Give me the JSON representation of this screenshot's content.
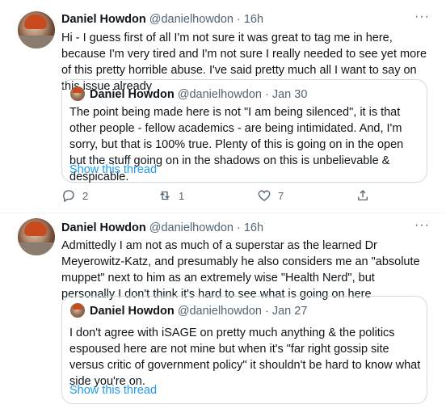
{
  "tweets": [
    {
      "author": "Daniel Howdon",
      "handle_time": "@danielhowdon · 16h",
      "text": "Hi - I guess first of all I'm not sure it was great to tag me in here, because I'm very tired and I'm not sure I really needed to see yet more of this pretty horrible abuse. I've said pretty much all I want to say on this issue already",
      "quote": {
        "author": "Daniel Howdon",
        "handle_time": "@danielhowdon · Jan 30",
        "text": "The point being made here is not \"I am being silenced\", it is that other people - fellow academics - are being intimidated. And, I'm sorry, but that is 100% true. Plenty of this is going on in the open but the stuff going on in the shadows on this is unbelievable & despicable.",
        "link": "Show this thread"
      },
      "actions": {
        "replies": "2",
        "retweets": "1",
        "likes": "7"
      }
    },
    {
      "author": "Daniel Howdon",
      "handle_time": "@danielhowdon · 16h",
      "text": "Admittedly I am not as much of a superstar as the learned Dr Meyerowitz-Katz, and presumably he also considers me an \"absolute muppet\" next to him as an extremely wise \"Health Nerd\", but personally I don't think it's hard to see what is going on here",
      "quote": {
        "author": "Daniel Howdon",
        "handle_time": "@danielhowdon · Jan 27",
        "text": "I don't agree with iSAGE on pretty much anything & the politics espoused here are not mine but when it's \"far right gossip site versus critic of government policy\" it shouldn't be hard to know what side you're on.",
        "link": "Show this thread"
      }
    }
  ],
  "more_icon": "···",
  "colors": {
    "link": "#1d9bf0",
    "secondary": "#536471",
    "border": "#cfd9de"
  },
  "icons": [
    "more-icon",
    "reply-icon",
    "retweet-icon",
    "like-icon",
    "share-icon"
  ]
}
